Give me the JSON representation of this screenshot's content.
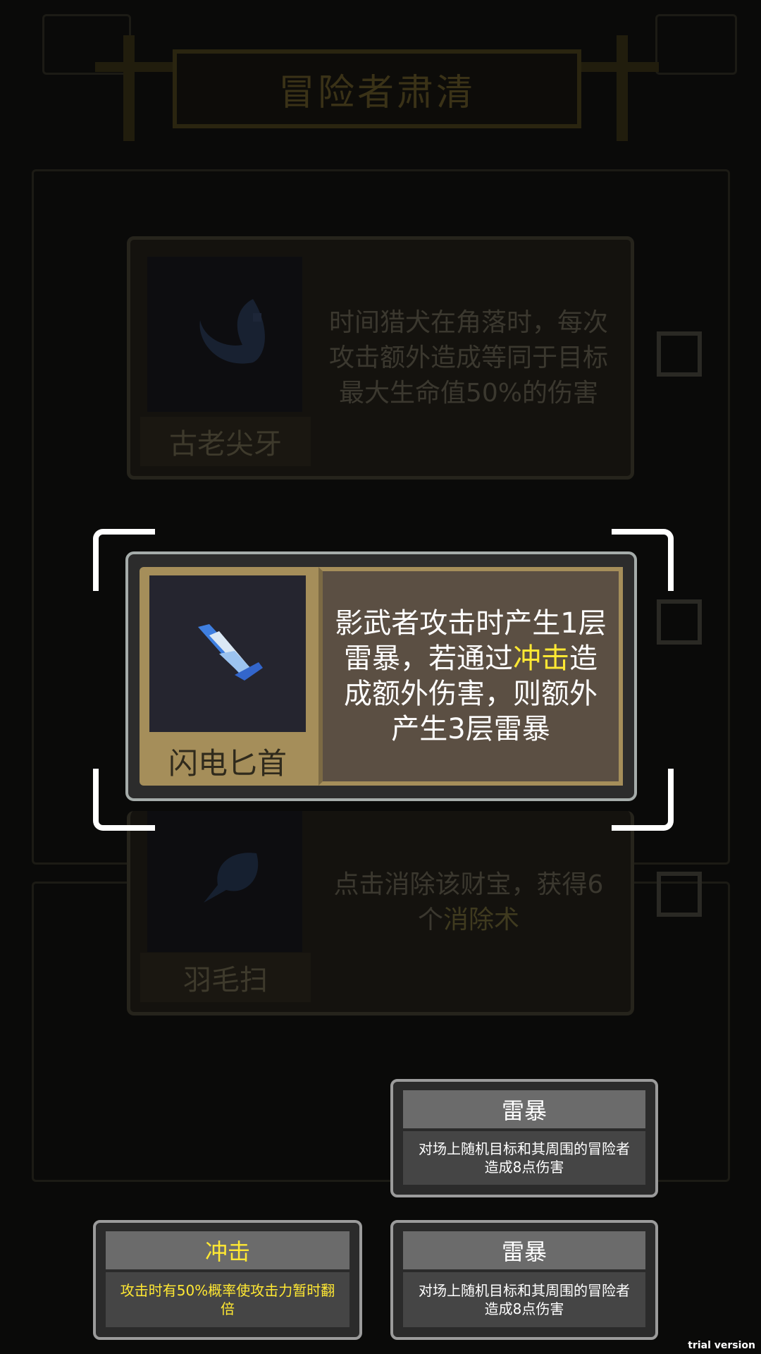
{
  "header": {
    "title": "冒险者肃清"
  },
  "cards": [
    {
      "name": "古老尖牙",
      "icon": "fang-icon",
      "description": "时间猎犬在角落时，每次攻击额外造成等同于目标最大生命值50%的伤害",
      "state": "dimmed"
    },
    {
      "name": "闪电匕首",
      "icon": "lightning-dagger-icon",
      "description_parts": [
        "影武者攻击时产生1层雷暴，若通过",
        "冲击",
        "造成额外伤害，则额外产生3层雷暴"
      ],
      "state": "selected"
    },
    {
      "name": "羽毛扫",
      "icon": "feather-duster-icon",
      "description_parts": [
        "点击消除该财宝，获得6个",
        "消除术"
      ],
      "state": "dimmed"
    }
  ],
  "tooltips": [
    {
      "title": "雷暴",
      "text": "对场上随机目标和其周围的冒险者造成8点伤害",
      "color": "#ffffff"
    },
    {
      "title": "冲击",
      "text": "攻击时有50%概率使攻击力暂时翻倍",
      "color": "#ffe833"
    },
    {
      "title": "雷暴",
      "text": "对场上随机目标和其周围的冒险者造成8点伤害",
      "color": "#ffffff"
    }
  ],
  "watermark": "trial version",
  "colors": {
    "accent_yellow": "#ffe833",
    "card_gold": "#a58e5a",
    "desc_brown": "#5b4f43"
  }
}
